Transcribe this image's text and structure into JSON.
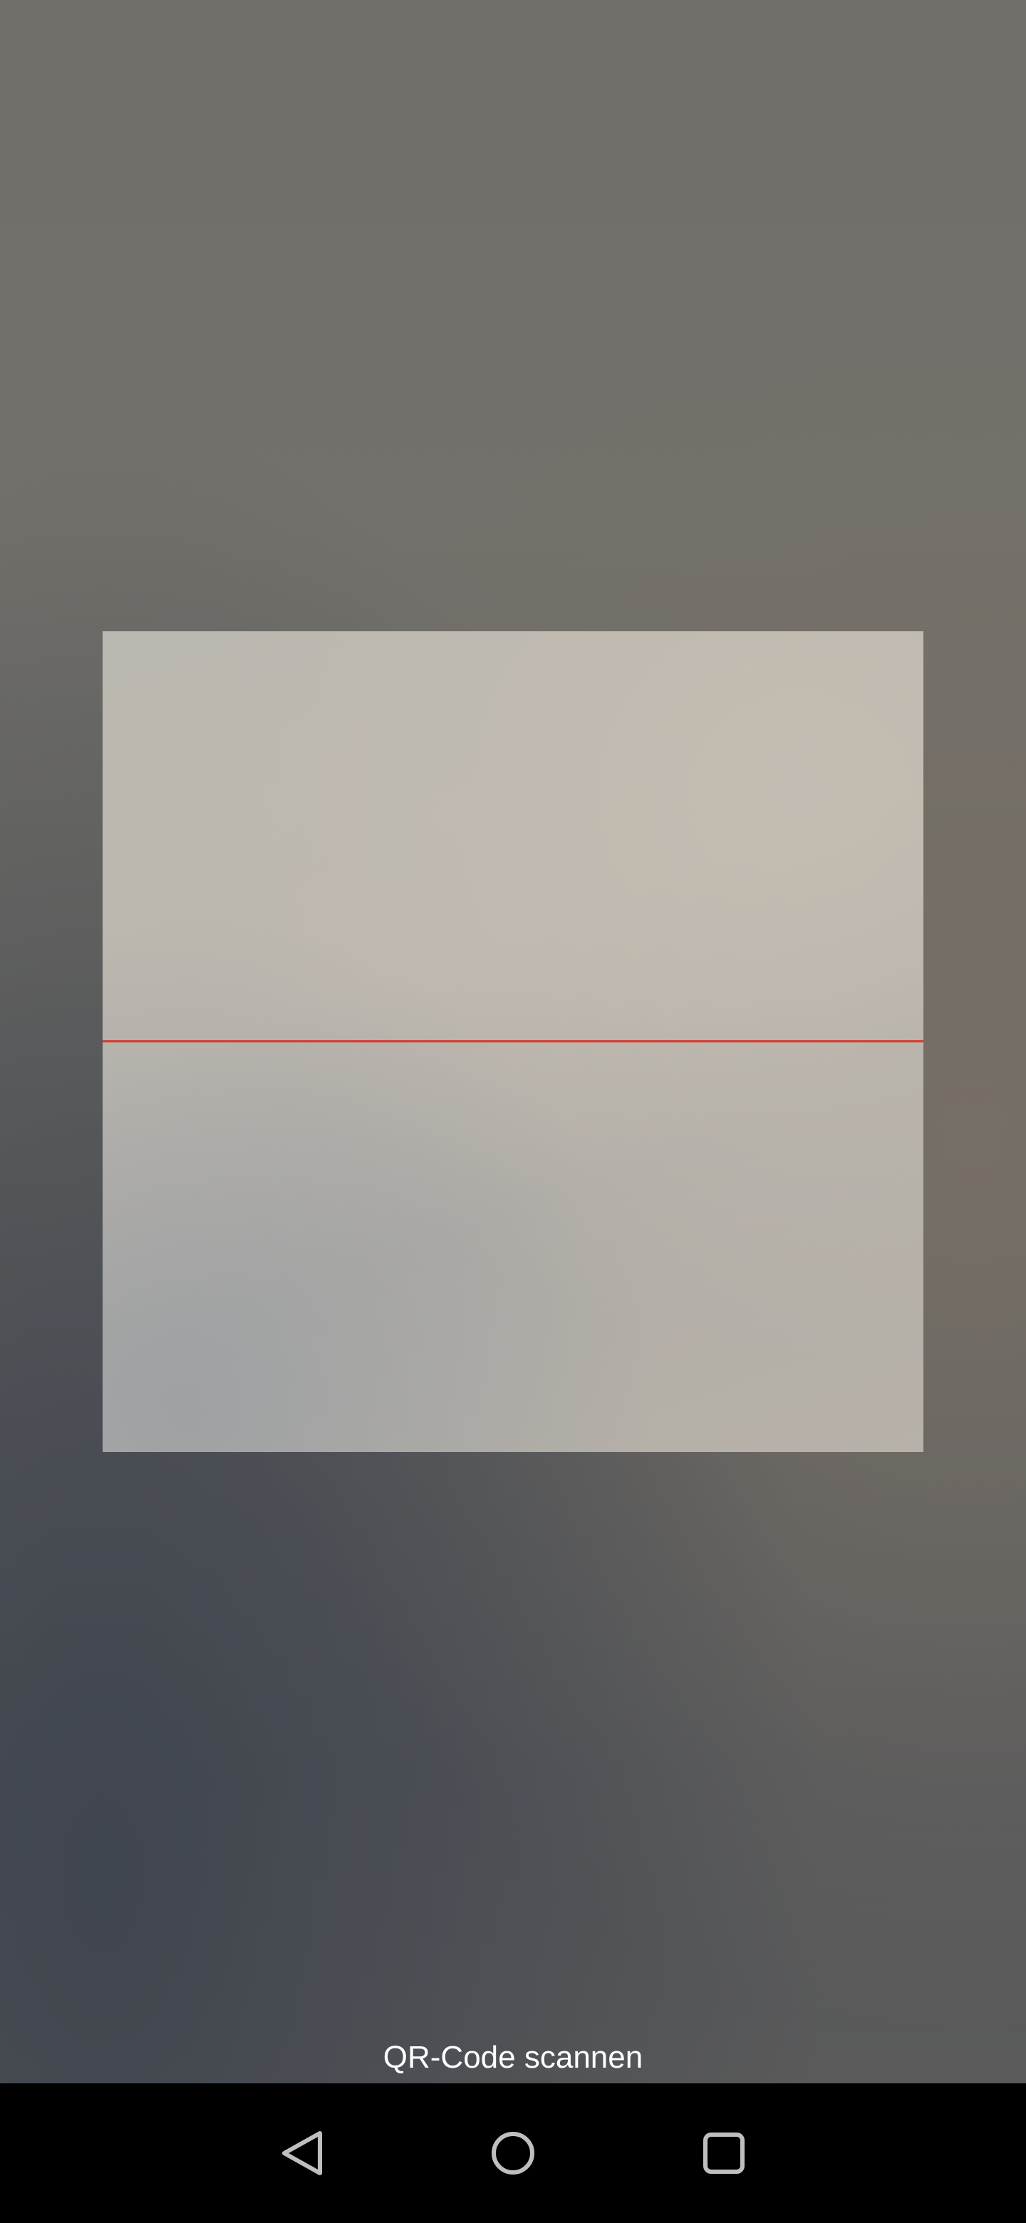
{
  "scanner": {
    "instruction_label": "QR-Code scannen",
    "scan_line_color": "#d8382f"
  },
  "navigation_bar": {
    "buttons": [
      {
        "icon": "back-triangle-icon"
      },
      {
        "icon": "home-circle-icon"
      },
      {
        "icon": "recents-square-icon"
      }
    ]
  }
}
